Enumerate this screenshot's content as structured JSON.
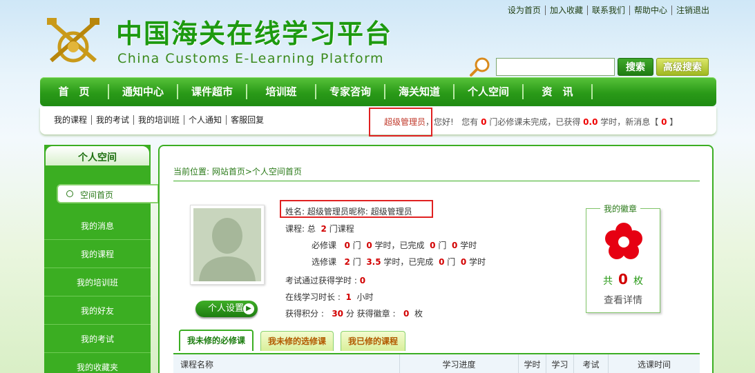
{
  "top_links": [
    "设为首页",
    "加入收藏",
    "联系我们",
    "帮助中心",
    "注销退出"
  ],
  "logo": {
    "cn": "中国海关在线学习平台",
    "en": "China Customs E-Learning Platform"
  },
  "search": {
    "value": "",
    "button": "搜索",
    "advanced": "高级搜索"
  },
  "main_nav": [
    "首　页",
    "通知中心",
    "课件超市",
    "培训班",
    "专家咨询",
    "海关知道",
    "个人空间",
    "资　讯"
  ],
  "sub_nav": [
    "我的课程",
    "我的考试",
    "我的培训班",
    "个人通知",
    "客服回复"
  ],
  "welcome": {
    "username": "超级管理员",
    "greeting": "，您好!",
    "text1": "您有",
    "required_unfinished": "0",
    "text2": "门必修课未完成，已获得",
    "hours": "0.0",
    "text3": "学时，新消息【",
    "new_messages": "0",
    "text4": "】"
  },
  "sidebar": {
    "title": "个人空间",
    "items": [
      "空间首页",
      "我的消息",
      "我的课程",
      "我的培训班",
      "我的好友",
      "我的考试",
      "我的收藏夹"
    ]
  },
  "breadcrumb": "当前位置: 网站首页>个人空间首页",
  "profile": {
    "name_line": "姓名: 超级管理员昵称: 超级管理员",
    "courses_label": "课程: 总",
    "courses_total": "2",
    "courses_unit": "门课程",
    "required": {
      "label": "必修课",
      "count": "0",
      "u1": "门",
      "hours": "0",
      "u2": "学时，已完成",
      "done": "0",
      "u3": "门",
      "done_hours": "0",
      "u4": "学时"
    },
    "elective": {
      "label": "选修课",
      "count": "2",
      "u1": "门",
      "hours": "3.5",
      "u2": "学时，已完成",
      "done": "0",
      "u3": "门",
      "done_hours": "0",
      "u4": "学时"
    },
    "exam_label": "考试通过获得学时 :",
    "exam_hours": "0",
    "online_label": "在线学习时长 :",
    "online_hours": "1",
    "online_unit": "小时",
    "points_label": "获得积分 :",
    "points": "30",
    "points_unit": "分 获得徽章 :",
    "badges": "0",
    "badges_unit": "枚",
    "settings_button": "个人设置"
  },
  "badge_panel": {
    "title": "我的徽章",
    "prefix": "共",
    "count": "0",
    "suffix": "枚",
    "detail": "查看详情"
  },
  "tabs": [
    "我未修的必修课",
    "我未修的选修课",
    "我已修的课程"
  ],
  "table_headers": [
    "课程名称",
    "学习进度",
    "学时",
    "学习",
    "考试",
    "选课时间"
  ],
  "colors": {
    "brand_green": "#3bae22",
    "highlight_red": "#e02020",
    "value_red": "#d20000"
  }
}
